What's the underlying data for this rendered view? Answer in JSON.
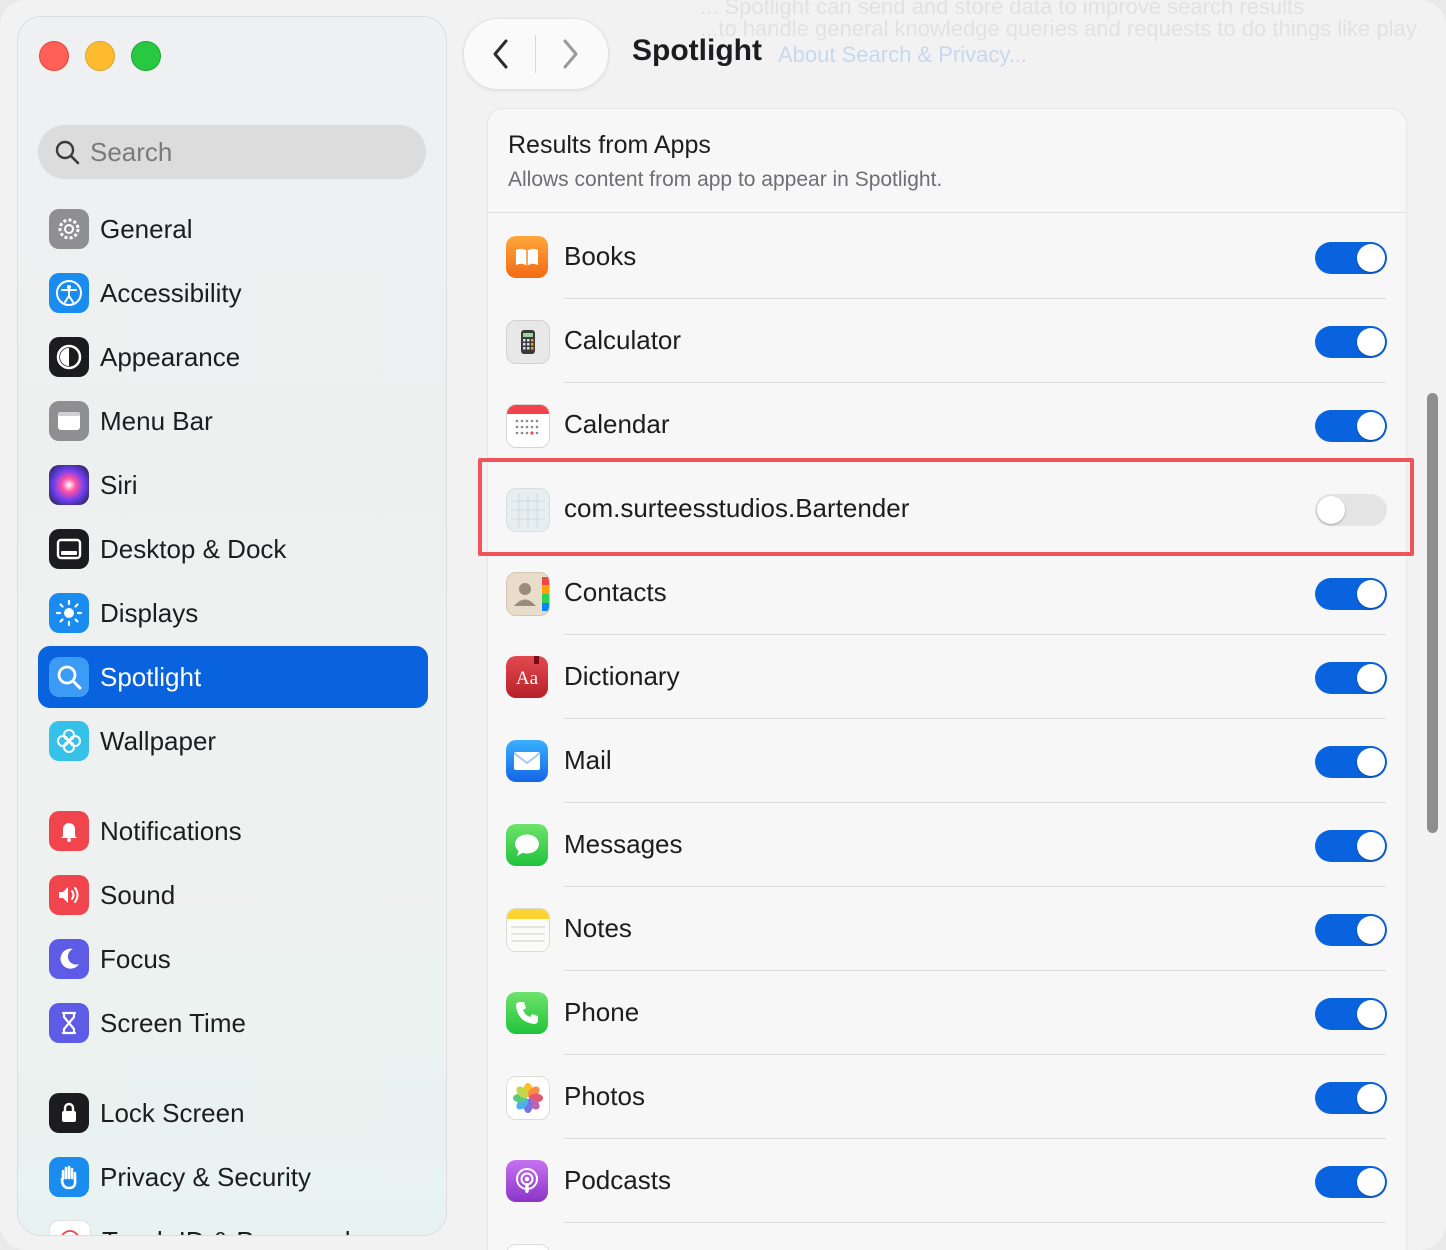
{
  "window": {
    "title": "Spotlight"
  },
  "sidebar": {
    "search_placeholder": "Search",
    "items": [
      {
        "label": "General",
        "icon": "gear-icon",
        "color": "#8e8e93"
      },
      {
        "label": "Accessibility",
        "icon": "accessibility-icon",
        "color": "#1a8cf0"
      },
      {
        "label": "Appearance",
        "icon": "appearance-icon",
        "color": "#1c1c1e"
      },
      {
        "label": "Menu Bar",
        "icon": "menu-bar-icon",
        "color": "#8e8e93"
      },
      {
        "label": "Siri",
        "icon": "siri-icon",
        "color": "#5b3fd4"
      },
      {
        "label": "Desktop & Dock",
        "icon": "dock-icon",
        "color": "#1c1c1e"
      },
      {
        "label": "Displays",
        "icon": "sun-icon",
        "color": "#1a8cf0"
      },
      {
        "label": "Spotlight",
        "icon": "spotlight-icon",
        "color": "#1a8cf0",
        "active": true
      },
      {
        "label": "Wallpaper",
        "icon": "wallpaper-icon",
        "color": "#35c1e8"
      },
      {
        "label": "Notifications",
        "icon": "bell-icon",
        "color": "#f0454d"
      },
      {
        "label": "Sound",
        "icon": "speaker-icon",
        "color": "#f0454d"
      },
      {
        "label": "Focus",
        "icon": "moon-icon",
        "color": "#5e5ce6"
      },
      {
        "label": "Screen Time",
        "icon": "hourglass-icon",
        "color": "#5e5ce6"
      },
      {
        "label": "Lock Screen",
        "icon": "lock-icon",
        "color": "#1c1c1e"
      },
      {
        "label": "Privacy & Security",
        "icon": "hand-icon",
        "color": "#1a8cf0"
      },
      {
        "label": "Touch ID & Password",
        "icon": "fingerprint-icon",
        "color": "#f0454d"
      }
    ]
  },
  "toolbar": {
    "title": "Spotlight",
    "link": "About Search & Privacy...",
    "ghost_lines": [
      "... Spotlight can send and store data to improve search results",
      "...to handle general knowledge queries and requests to do things like play"
    ]
  },
  "panel": {
    "title": "Results from Apps",
    "subtitle": "Allows content from app to appear in Spotlight.",
    "apps": [
      {
        "name": "Books",
        "icon": "books-icon",
        "enabled": true
      },
      {
        "name": "Calculator",
        "icon": "calculator-icon",
        "enabled": true
      },
      {
        "name": "Calendar",
        "icon": "calendar-icon",
        "enabled": true
      },
      {
        "name": "com.surteesstudios.Bartender",
        "icon": "bartender-icon",
        "enabled": false
      },
      {
        "name": "Contacts",
        "icon": "contacts-icon",
        "enabled": true
      },
      {
        "name": "Dictionary",
        "icon": "dictionary-icon",
        "enabled": true
      },
      {
        "name": "Mail",
        "icon": "mail-icon",
        "enabled": true
      },
      {
        "name": "Messages",
        "icon": "messages-icon",
        "enabled": true
      },
      {
        "name": "Notes",
        "icon": "notes-icon",
        "enabled": true
      },
      {
        "name": "Phone",
        "icon": "phone-icon",
        "enabled": true
      },
      {
        "name": "Photos",
        "icon": "photos-icon",
        "enabled": true
      },
      {
        "name": "Podcasts",
        "icon": "podcasts-icon",
        "enabled": true
      }
    ]
  },
  "colors": {
    "accent": "#0a63de",
    "highlight": "#f0545b"
  }
}
